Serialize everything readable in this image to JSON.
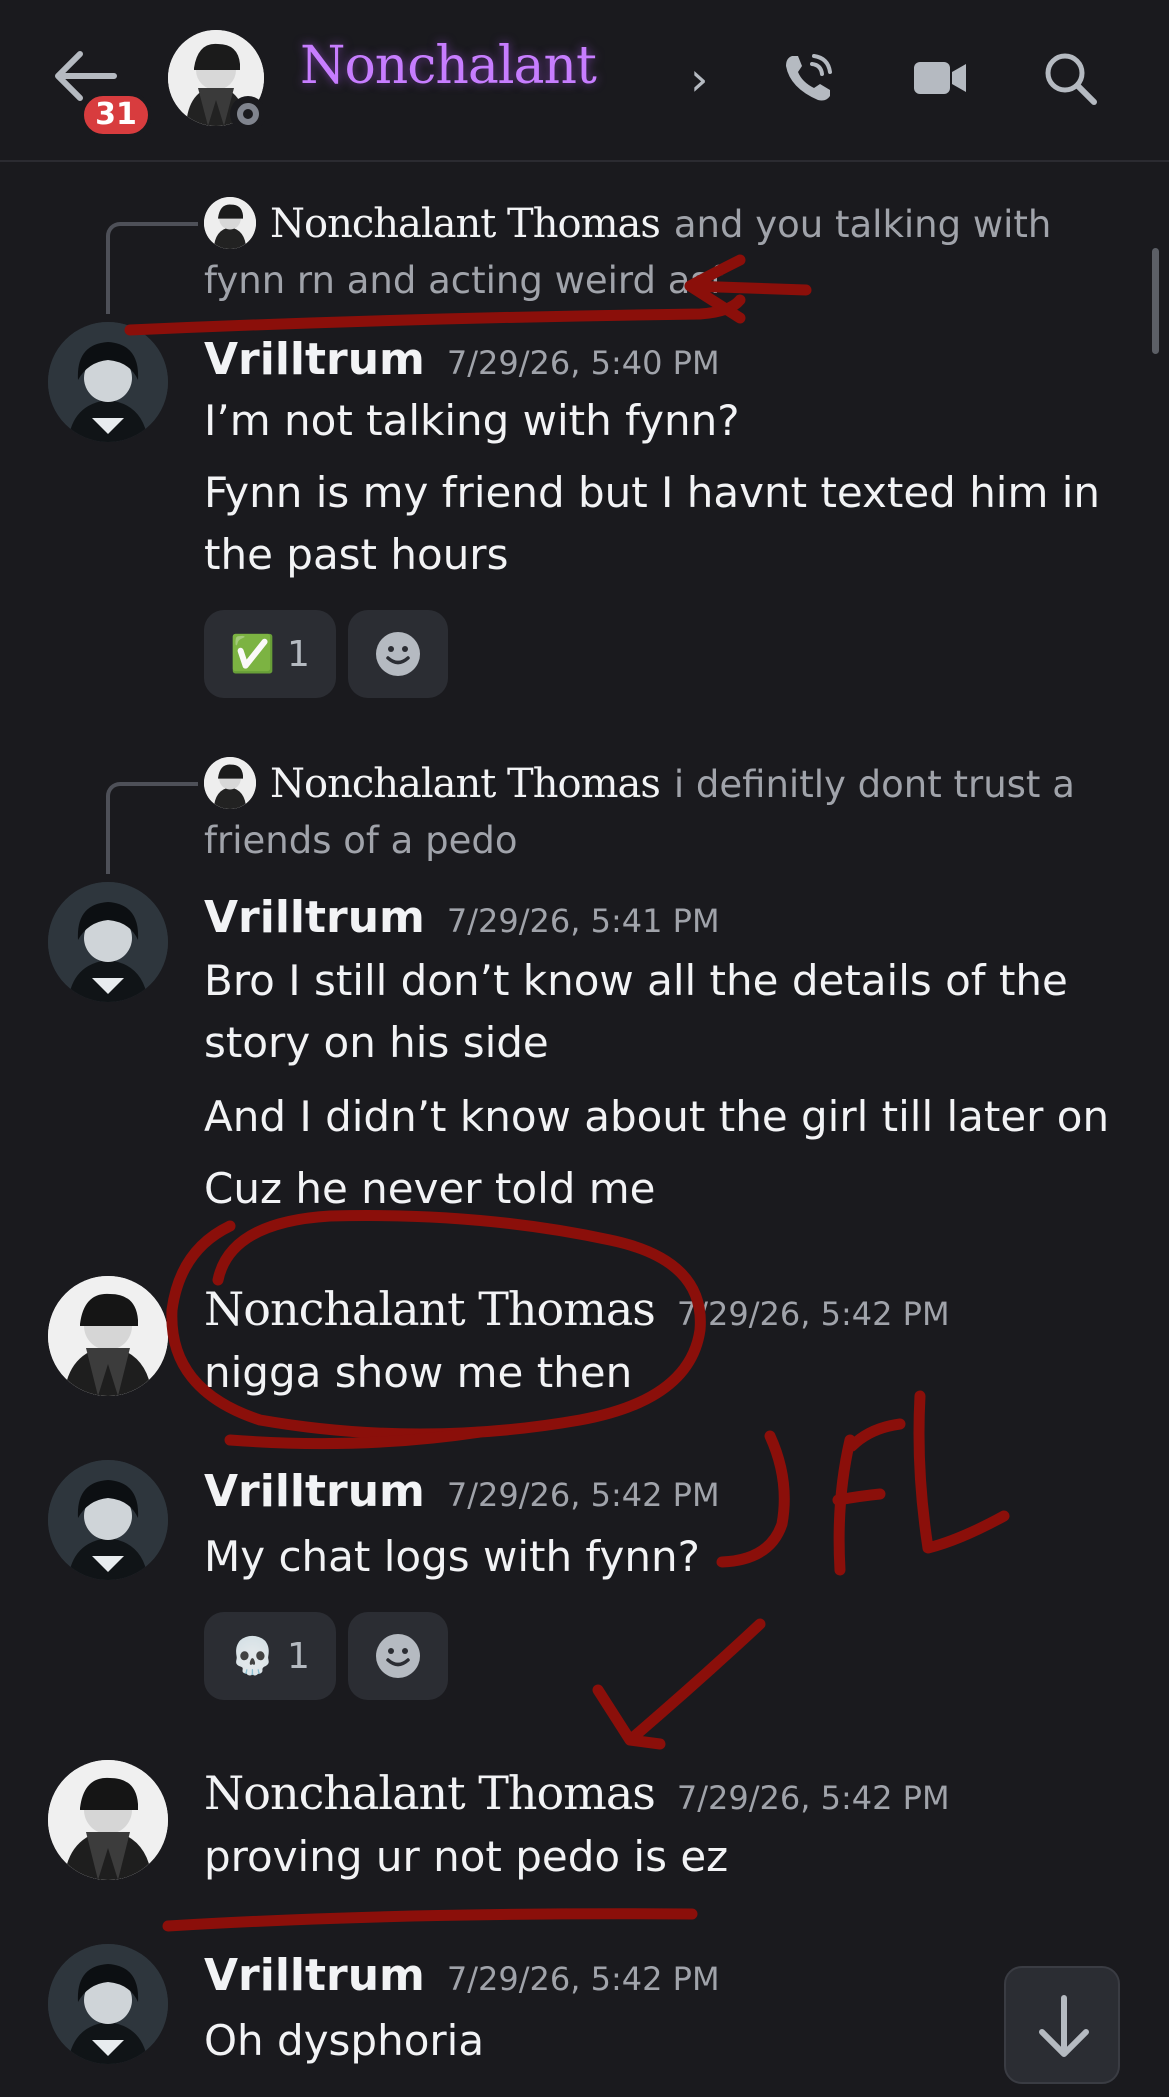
{
  "header": {
    "unread_count": "31",
    "title": "Nonchalant",
    "chevron": "›",
    "icons": [
      "back-arrow-icon",
      "phone-icon",
      "video-camera-icon",
      "search-icon"
    ]
  },
  "messages": [
    {
      "reply_name": "Nonchalant Thomas",
      "reply_text": "and you talking with fynn rn and acting weird asf",
      "author": "Vrilltrum",
      "timestamp": "7/29/26, 5:40 PM",
      "lines": [
        "I’m not talking with fynn?",
        "Fynn is my friend but I havnt texted him in the past hours"
      ],
      "reaction": {
        "emoji": "✅",
        "count": "1"
      }
    },
    {
      "reply_name": "Nonchalant Thomas",
      "reply_text": "i definitly dont trust a friends of a pedo",
      "author": "Vrilltrum",
      "timestamp": "7/29/26, 5:41 PM",
      "lines": [
        "Bro I still don’t know all the details of the story on his side",
        "And I didn’t know about the girl till later on",
        "Cuz he never told me"
      ]
    },
    {
      "author": "Nonchalant Thomas",
      "timestamp": "7/29/26, 5:42 PM",
      "lines": [
        "nigga show me then"
      ]
    },
    {
      "author": "Vrilltrum",
      "timestamp": "7/29/26, 5:42 PM",
      "lines": [
        "My chat logs with fynn?"
      ],
      "reaction": {
        "emoji": "💀",
        "count": "1"
      }
    },
    {
      "author": "Nonchalant Thomas",
      "timestamp": "7/29/26, 5:42 PM",
      "lines": [
        "proving ur not pedo is ez"
      ]
    },
    {
      "author": "Vrilltrum",
      "timestamp": "7/29/26, 5:42 PM",
      "lines": [
        "Oh dysphoria"
      ]
    }
  ],
  "annotations": {
    "handwritten_text": "JFL",
    "ink_color": "#8b0f0a"
  },
  "colors": {
    "background": "#1a1a1e",
    "title_purple": "#c77dff",
    "badge_red": "#d83c3e",
    "muted": "#a0a3aa"
  }
}
